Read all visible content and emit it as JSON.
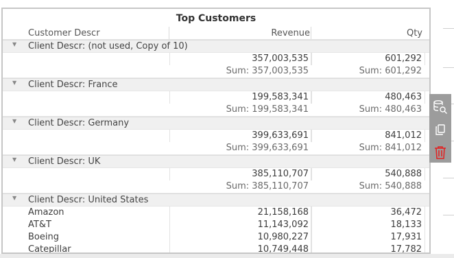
{
  "widget": {
    "title": "Top Customers",
    "columns": [
      "Customer Descr",
      "Revenue",
      "Qty"
    ]
  },
  "groups": [
    {
      "label": "Client Descr: (not used, Copy of 10)",
      "rows": [
        {
          "name": "",
          "revenue": "357,003,535",
          "qty": "601,292"
        }
      ],
      "sum": {
        "revenue": "Sum: 357,003,535",
        "qty": "Sum: 601,292"
      }
    },
    {
      "label": "Client Descr: France",
      "rows": [
        {
          "name": "",
          "revenue": "199,583,341",
          "qty": "480,463"
        }
      ],
      "sum": {
        "revenue": "Sum: 199,583,341",
        "qty": "Sum: 480,463"
      }
    },
    {
      "label": "Client Descr: Germany",
      "rows": [
        {
          "name": "",
          "revenue": "399,633,691",
          "qty": "841,012"
        }
      ],
      "sum": {
        "revenue": "Sum: 399,633,691",
        "qty": "Sum: 841,012"
      }
    },
    {
      "label": "Client Descr: UK",
      "rows": [
        {
          "name": "",
          "revenue": "385,110,707",
          "qty": "540,888"
        }
      ],
      "sum": {
        "revenue": "Sum: 385,110,707",
        "qty": "Sum: 540,888"
      }
    },
    {
      "label": "Client Descr: United States",
      "rows": [
        {
          "name": "Amazon",
          "revenue": "21,158,168",
          "qty": "36,472"
        },
        {
          "name": "AT&T",
          "revenue": "11,143,092",
          "qty": "18,133"
        },
        {
          "name": "Boeing",
          "revenue": "10,980,227",
          "qty": "17,931"
        },
        {
          "name": "Catepillar",
          "revenue": "10,749,448",
          "qty": "17,782"
        }
      ]
    }
  ],
  "toolbar": {
    "icons": [
      "database-search-icon",
      "copy-icon",
      "trash-icon"
    ],
    "icon_color": "#ffffff",
    "delete_color": "#e02424"
  }
}
